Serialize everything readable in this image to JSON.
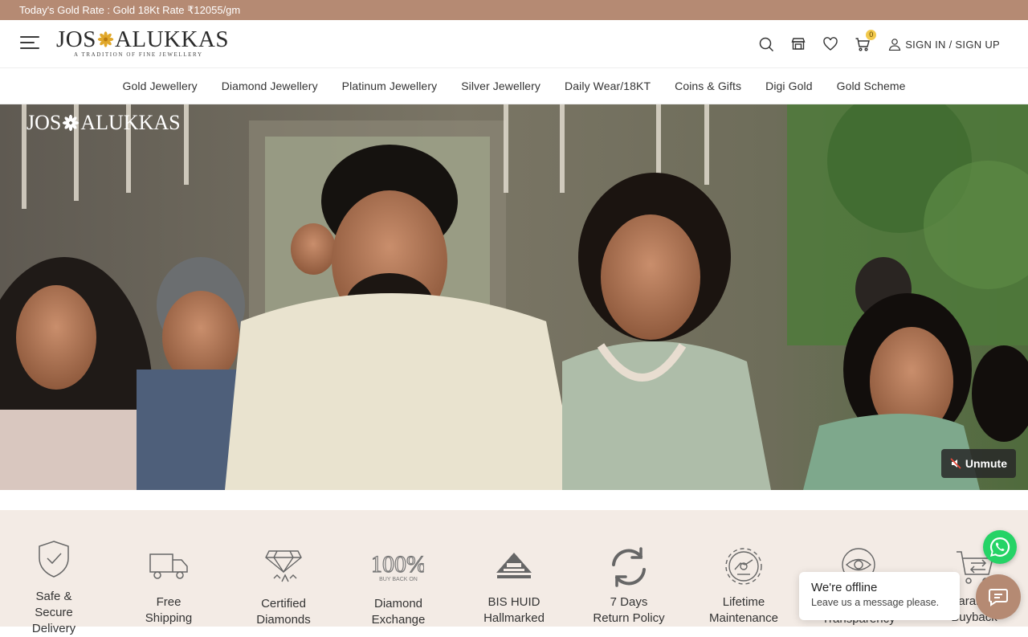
{
  "topbar": {
    "gold_rate": "Today's Gold Rate : Gold 18Kt Rate ₹12055/gm"
  },
  "header": {
    "logo_left": "JOS",
    "logo_right": "ALUKKAS",
    "tagline": "A TRADITION OF FINE JEWELLERY",
    "cart_count": "0",
    "signin_label": "SIGN IN / SIGN UP"
  },
  "nav": {
    "items": [
      {
        "label": "Gold Jewellery"
      },
      {
        "label": "Diamond Jewellery"
      },
      {
        "label": "Platinum Jewellery"
      },
      {
        "label": "Silver Jewellery"
      },
      {
        "label": "Daily Wear/18KT"
      },
      {
        "label": "Coins & Gifts"
      },
      {
        "label": "Digi Gold"
      },
      {
        "label": "Gold Scheme"
      }
    ]
  },
  "hero": {
    "logo_left": "JOS",
    "logo_right": "ALUKKAS",
    "unmute_label": "Unmute"
  },
  "features": [
    {
      "line1": "Safe &",
      "line2": "Secure",
      "line3": "Delivery",
      "icon": "shield-check-icon"
    },
    {
      "line1": "Free",
      "line2": "Shipping",
      "icon": "truck-icon"
    },
    {
      "line1": "Certified",
      "line2": "Diamonds",
      "icon": "diamond-certificate-icon"
    },
    {
      "line1": "Diamond",
      "line2": "Exchange",
      "icon": "buyback-100-icon",
      "badge_top": "100%",
      "badge_bottom": "BUY BACK ON"
    },
    {
      "line1": "BIS HUID",
      "line2": "Hallmarked",
      "icon": "bis-hallmark-icon"
    },
    {
      "line1": "7 Days",
      "line2": "Return Policy",
      "icon": "return-arrows-icon"
    },
    {
      "line1": "Lifetime",
      "line2": "Maintenance",
      "icon": "maintenance-gear-icon"
    },
    {
      "line1": "Transparency",
      "icon": "eye-icon"
    },
    {
      "line1": "Guaranteed",
      "line2": "Buyback",
      "icon": "cart-exchange-icon"
    }
  ],
  "chat": {
    "offline_title": "We're offline",
    "offline_sub": "Leave us a message please."
  },
  "colors": {
    "topbar": "#b58a73",
    "features_bg": "#f3ebe5",
    "badge": "#f2c94c",
    "whatsapp": "#25d366"
  }
}
